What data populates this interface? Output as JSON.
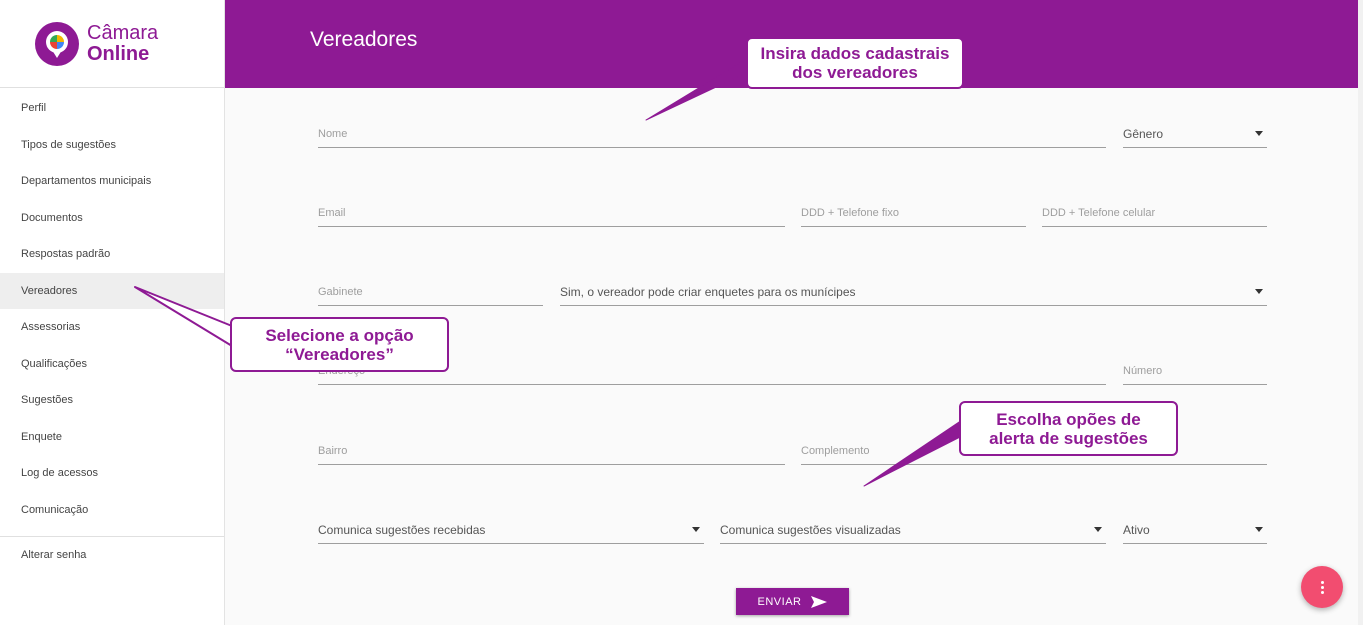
{
  "app": {
    "logo_line1": "Câmara",
    "logo_line2": "Online"
  },
  "sidebar": {
    "items": [
      {
        "label": "Perfil"
      },
      {
        "label": "Tipos de sugestões"
      },
      {
        "label": "Departamentos municipais"
      },
      {
        "label": "Documentos"
      },
      {
        "label": "Respostas padrão"
      },
      {
        "label": "Vereadores"
      },
      {
        "label": "Assessorias"
      },
      {
        "label": "Qualificações"
      },
      {
        "label": "Sugestões"
      },
      {
        "label": "Enquete"
      },
      {
        "label": "Log de acessos"
      },
      {
        "label": "Comunicação"
      }
    ],
    "footer_item": {
      "label": "Alterar senha"
    },
    "active_item": "Vereadores"
  },
  "header": {
    "title": "Vereadores"
  },
  "form": {
    "nome": {
      "placeholder": "Nome"
    },
    "genero": {
      "label": "Gênero"
    },
    "email": {
      "placeholder": "Email"
    },
    "telefone_fixo": {
      "placeholder": "DDD + Telefone fixo"
    },
    "telefone_celular": {
      "placeholder": "DDD + Telefone celular"
    },
    "gabinete": {
      "placeholder": "Gabinete"
    },
    "enquetes": {
      "value": "Sim, o vereador pode criar enquetes para os munícipes"
    },
    "endereco": {
      "placeholder": "Endereço"
    },
    "numero": {
      "placeholder": "Número"
    },
    "bairro": {
      "placeholder": "Bairro"
    },
    "complemento": {
      "placeholder": "Complemento"
    },
    "comunica_recebidas": {
      "value": "Comunica sugestões recebidas"
    },
    "comunica_visualizadas": {
      "value": "Comunica sugestões visualizadas"
    },
    "ativo": {
      "value": "Ativo"
    },
    "submit_label": "ENVIAR"
  },
  "callouts": {
    "dados": {
      "line1": "Insira dados cadastrais",
      "line2": "dos vereadores"
    },
    "selecione": {
      "line1": "Selecione a opção",
      "line2": "“Vereadores”"
    },
    "alerta": {
      "line1": "Escolha opões de",
      "line2": "alerta de sugestões"
    }
  },
  "colors": {
    "primary": "#8e1a94",
    "fab": "#f24d70"
  },
  "icons": {
    "submit": "send-icon",
    "fab": "more-vert-icon",
    "select": "caret-down-icon"
  }
}
